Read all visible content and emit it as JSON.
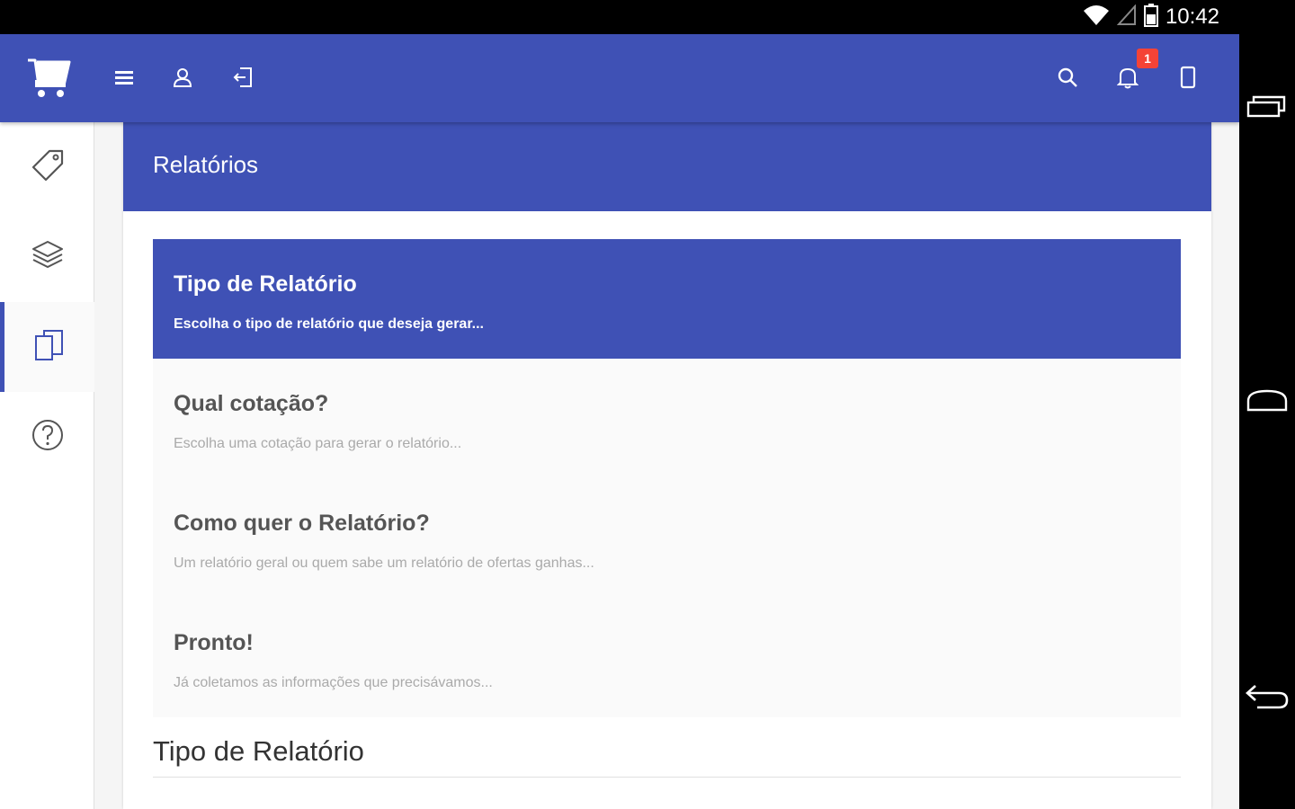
{
  "status_bar": {
    "time": "10:42"
  },
  "top_bar": {
    "notification_count": "1",
    "icons": [
      "cart-logo-icon",
      "menu-icon",
      "user-icon",
      "logout-icon",
      "search-icon",
      "bell-icon",
      "mobile-icon"
    ]
  },
  "sidebar": {
    "items": [
      {
        "icon": "tag-icon"
      },
      {
        "icon": "layers-icon"
      },
      {
        "icon": "reports-icon",
        "active": true
      },
      {
        "icon": "help-icon"
      }
    ]
  },
  "content": {
    "title": "Relatórios",
    "steps": [
      {
        "title": "Tipo de Relatório",
        "description": "Escolha o tipo de relatório que deseja gerar..."
      },
      {
        "title": "Qual cotação?",
        "description": "Escolha uma cotação para gerar o relatório..."
      },
      {
        "title": "Como quer o Relatório?",
        "description": "Um relatório geral ou quem sabe um relatório de ofertas ganhas..."
      },
      {
        "title": "Pronto!",
        "description": "Já coletamos as informações que precisávamos..."
      }
    ],
    "section_title": "Tipo de Relatório"
  },
  "colors": {
    "primary": "#3f51b5",
    "badge": "#f44336"
  }
}
